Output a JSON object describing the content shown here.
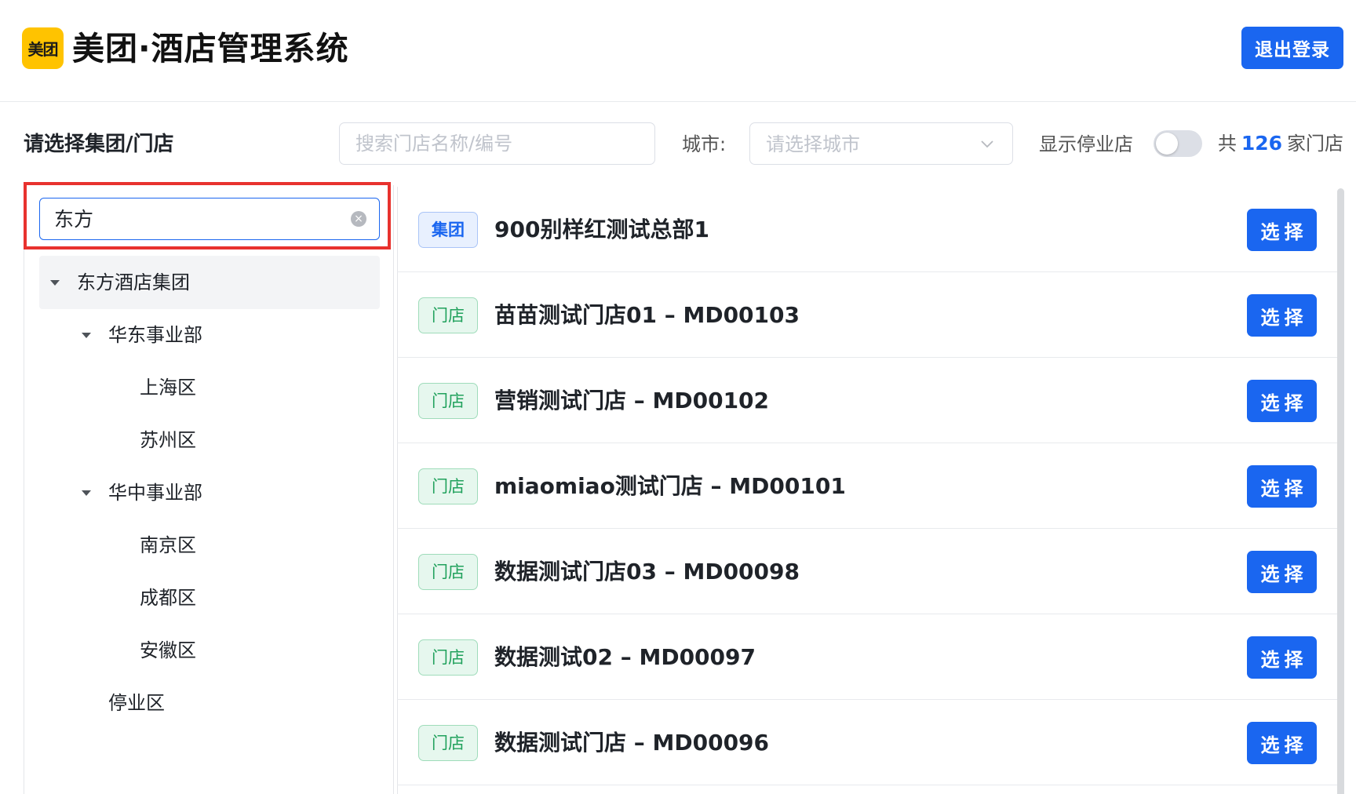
{
  "header": {
    "logo_text": "美团",
    "title": "美团·酒店管理系统",
    "logout_label": "退出登录"
  },
  "toolbar": {
    "select_title": "请选择集团/门店",
    "search_placeholder": "搜索门店名称/编号",
    "city_label": "城市:",
    "city_placeholder": "请选择城市",
    "show_closed_label": "显示停业店",
    "show_closed_on": false,
    "total_prefix": "共",
    "total_count": "126",
    "total_suffix": "家门店"
  },
  "tree": {
    "search_value": "东方",
    "nodes": [
      {
        "label": "东方酒店集团",
        "level": 0,
        "expanded": true
      },
      {
        "label": "华东事业部",
        "level": 1,
        "expanded": true
      },
      {
        "label": "上海区",
        "level": 2
      },
      {
        "label": "苏州区",
        "level": 2
      },
      {
        "label": "华中事业部",
        "level": 1,
        "expanded": true
      },
      {
        "label": "南京区",
        "level": 2
      },
      {
        "label": "成都区",
        "level": 2
      },
      {
        "label": "安徽区",
        "level": 2
      },
      {
        "label": "停业区",
        "level": 1
      }
    ]
  },
  "list": {
    "choose_label": "选择",
    "rows": [
      {
        "tag": "集团",
        "type": "group",
        "name": "900别样红测试总部1"
      },
      {
        "tag": "门店",
        "type": "store",
        "name": "苗苗测试门店01 – MD00103"
      },
      {
        "tag": "门店",
        "type": "store",
        "name": "营销测试门店 – MD00102"
      },
      {
        "tag": "门店",
        "type": "store",
        "name": "miaomiao测试门店 – MD00101"
      },
      {
        "tag": "门店",
        "type": "store",
        "name": "数据测试门店03 – MD00098"
      },
      {
        "tag": "门店",
        "type": "store",
        "name": "数据测试02 – MD00097"
      },
      {
        "tag": "门店",
        "type": "store",
        "name": "数据测试门店 – MD00096"
      }
    ]
  },
  "colors": {
    "primary": "#1a66f0",
    "logo": "#ffc300",
    "highlight": "#e8322e",
    "store_tag": "#20a15c"
  }
}
